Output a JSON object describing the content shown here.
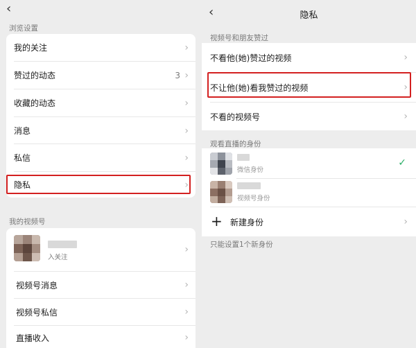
{
  "left": {
    "browse_section": "浏览设置",
    "items": [
      {
        "label": "我的关注"
      },
      {
        "label": "赞过的动态",
        "count": "3"
      },
      {
        "label": "收藏的动态"
      },
      {
        "label": "消息"
      },
      {
        "label": "私信"
      },
      {
        "label": "隐私"
      }
    ],
    "channel_section": "我的视频号",
    "profile_sub": "入关注",
    "channel_items": [
      {
        "label": "视频号消息"
      },
      {
        "label": "视频号私信"
      },
      {
        "label": "直播收入"
      }
    ]
  },
  "right": {
    "title": "隐私",
    "section1": "视频号和朋友赞过",
    "items": [
      {
        "label": "不看他(她)赞过的视频"
      },
      {
        "label": "不让他(她)看我赞过的视频"
      },
      {
        "label": "不看的视频号"
      }
    ],
    "section2": "观看直播的身份",
    "identities": [
      {
        "sub": "微信身份"
      },
      {
        "sub": "视频号身份"
      }
    ],
    "new_identity": "新建身份",
    "footnote": "只能设置1个新身份"
  },
  "icons": {
    "back": "chevron-left-icon",
    "chevron": "chevron-right-icon",
    "check": "checkmark-icon",
    "plus": "plus-icon"
  },
  "colors": {
    "highlight": "#d32020",
    "check": "#2aae67",
    "background": "#ededed"
  }
}
